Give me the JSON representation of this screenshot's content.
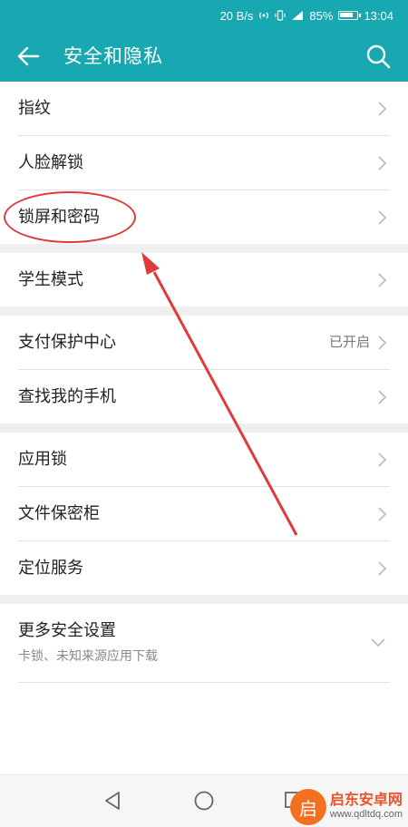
{
  "status_bar": {
    "speed": "20 B/s",
    "battery": "85%",
    "battery_level": 0.85,
    "time": "13:04"
  },
  "app_bar": {
    "title": "安全和隐私",
    "back_icon": "back-arrow-icon",
    "search_icon": "search-icon",
    "color": "#17a8b2"
  },
  "groups": [
    {
      "items": [
        {
          "label": "指纹"
        },
        {
          "label": "人脸解锁"
        },
        {
          "label": "锁屏和密码"
        }
      ]
    },
    {
      "items": [
        {
          "label": "学生模式"
        }
      ]
    },
    {
      "items": [
        {
          "label": "支付保护中心",
          "value": "已开启"
        },
        {
          "label": "查找我的手机"
        }
      ]
    },
    {
      "items": [
        {
          "label": "应用锁"
        },
        {
          "label": "文件保密柜"
        },
        {
          "label": "定位服务"
        }
      ]
    },
    {
      "items": [
        {
          "label": "更多安全设置",
          "subtitle": "卡锁、未知来源应用下载"
        }
      ]
    }
  ],
  "annotation": {
    "color": "#e03a3a"
  },
  "watermark": {
    "logo_char": "启",
    "title": "启东安卓网",
    "url": "www.qdltdq.com"
  }
}
